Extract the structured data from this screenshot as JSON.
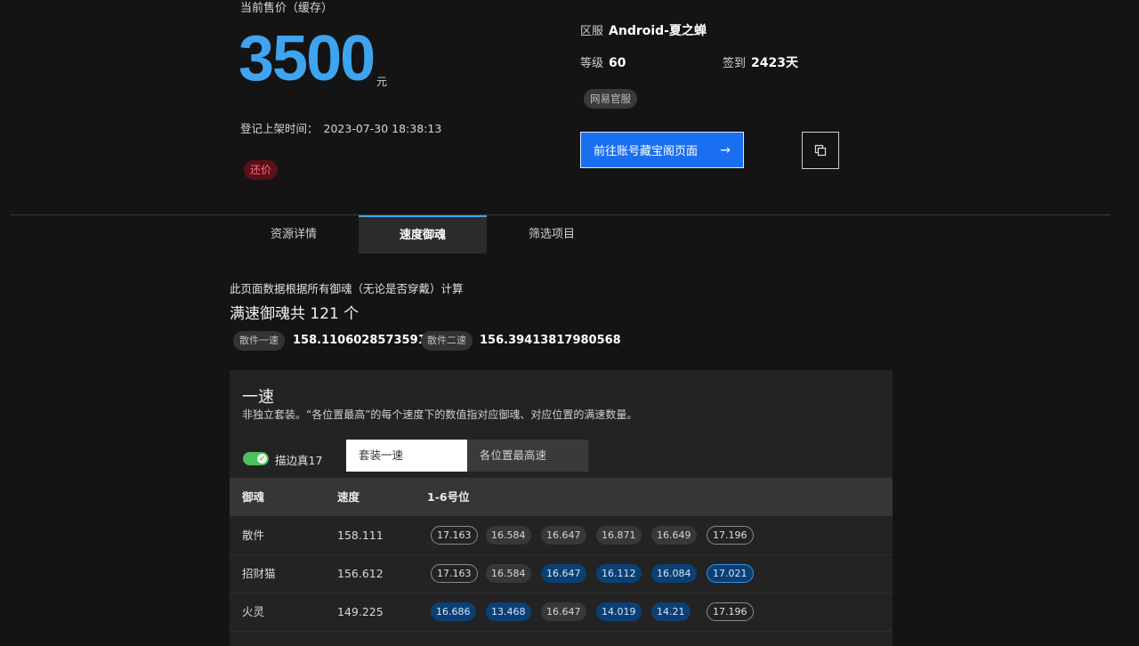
{
  "account": {
    "price_label": "当前售价（缓存）",
    "price": "3500",
    "price_unit": "元",
    "listed_label": "登记上架时间：",
    "listed_time": "2023-07-30 18:38:13",
    "bargain_tag": "还价",
    "server_label": "区服",
    "server_value": "Android-夏之蝉",
    "level_label": "等级",
    "level_value": "60",
    "checkin_label": "签到",
    "checkin_value": "2423天",
    "official_tag": "网易官服",
    "goto_label": "前往账号藏宝阁页面",
    "goto_arrow": "→"
  },
  "tabs": [
    {
      "label": "资源详情",
      "active": false
    },
    {
      "label": "速度御魂",
      "active": true
    },
    {
      "label": "筛选项目",
      "active": false
    }
  ],
  "speed": {
    "note": "此页面数据根据所有御魂（无论是否穿戴）计算",
    "count_text": "满速御魂共 121 个",
    "chip1_label": "散件一速",
    "chip1_value": "158.11060285735914",
    "chip2_label": "散件二速",
    "chip2_value": "156.39413817980568"
  },
  "panel": {
    "title": "一速",
    "desc": "非独立套装。“各位置最高”的每个速度下的数值指对应御魂、对应位置的满速数量。",
    "toggle_label": "描边真17",
    "toggle_on": true,
    "seg_on": "套装一速",
    "seg_off": "各位置最高速",
    "headers": [
      "御魂",
      "速度",
      "1-6号位"
    ],
    "rows": [
      {
        "name": "散件",
        "speed": "158.111",
        "slots": [
          {
            "v": "17.163",
            "s": "outline"
          },
          {
            "v": "16.584",
            "s": "gray"
          },
          {
            "v": "16.647",
            "s": "gray"
          },
          {
            "v": "16.871",
            "s": "gray"
          },
          {
            "v": "16.649",
            "s": "gray"
          },
          {
            "v": "17.196",
            "s": "outline"
          }
        ]
      },
      {
        "name": "招财猫",
        "speed": "156.612",
        "slots": [
          {
            "v": "17.163",
            "s": "outline"
          },
          {
            "v": "16.584",
            "s": "gray"
          },
          {
            "v": "16.647",
            "s": "blue"
          },
          {
            "v": "16.112",
            "s": "blue"
          },
          {
            "v": "16.084",
            "s": "blue"
          },
          {
            "v": "17.021",
            "s": "blue-outline"
          }
        ]
      },
      {
        "name": "火灵",
        "speed": "149.225",
        "slots": [
          {
            "v": "16.686",
            "s": "blue"
          },
          {
            "v": "13.468",
            "s": "blue"
          },
          {
            "v": "16.647",
            "s": "gray"
          },
          {
            "v": "14.019",
            "s": "blue"
          },
          {
            "v": "14.21",
            "s": "blue"
          },
          {
            "v": "17.196",
            "s": "outline"
          }
        ]
      }
    ]
  }
}
